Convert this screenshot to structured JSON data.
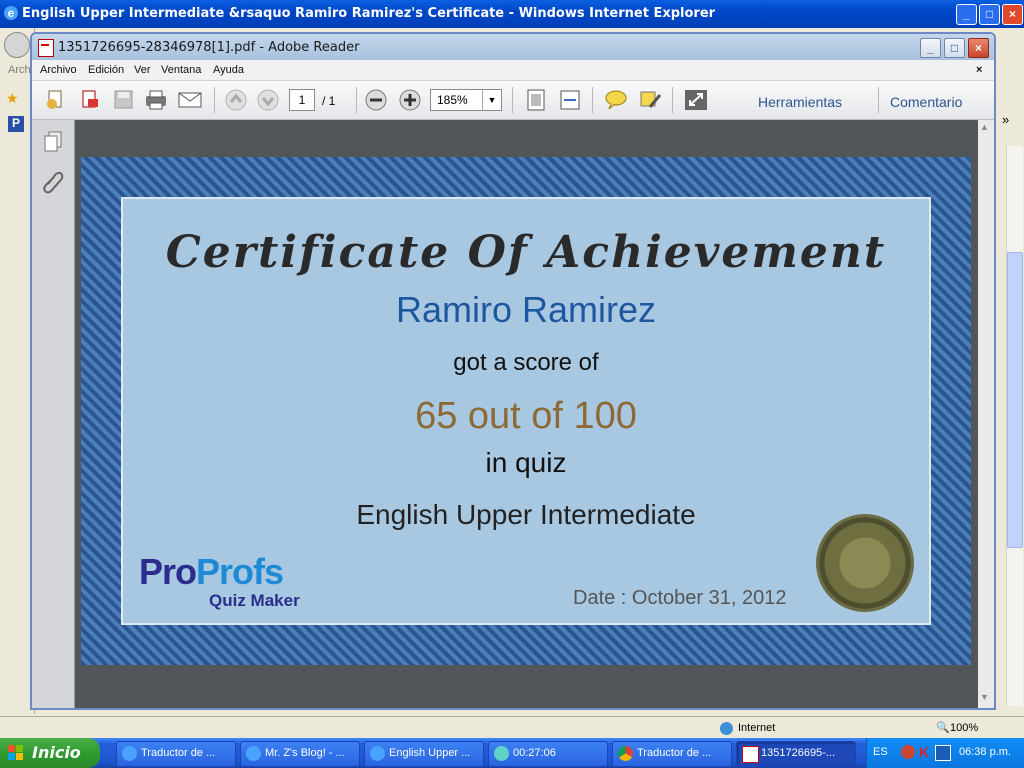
{
  "ie": {
    "title": "English Upper Intermediate &rsaquo Ramiro Ramirez's Certificate - Windows Internet Explorer",
    "status_zone": "Internet",
    "status_zoom": "100%",
    "fav_fragment": "Arch"
  },
  "adobe": {
    "title": "1351726695-28346978[1].pdf - Adobe Reader",
    "menu": [
      "Archivo",
      "Edición",
      "Ver",
      "Ventana",
      "Ayuda"
    ],
    "page_current": "1",
    "page_total": "/ 1",
    "zoom": "185%",
    "tools_label": "Herramientas",
    "comment_label": "Comentario"
  },
  "certificate": {
    "title": "Certificate Of Achievement",
    "name": "Ramiro Ramirez",
    "score_prefix": "got a score of",
    "score": "65 out of 100",
    "quiz_prefix": "in quiz",
    "quiz_name": "English Upper Intermediate",
    "date": "Date : October 31, 2012",
    "logo_pro": "Pro",
    "logo_profs": "Profs",
    "logo_sub": "Quiz Maker"
  },
  "taskbar": {
    "start": "Inicio",
    "tasks": [
      {
        "label": "Traductor de ...",
        "icon": "ie-icon"
      },
      {
        "label": "Mr. Z's Blog! - ...",
        "icon": "ie-icon"
      },
      {
        "label": "English Upper ...",
        "icon": "ie-icon"
      },
      {
        "label": "00:27:06",
        "icon": "timer-icon"
      },
      {
        "label": "Traductor de ...",
        "icon": "chrome-icon"
      },
      {
        "label": "1351726695-...",
        "icon": "pdf-icon"
      }
    ],
    "lang": "ES",
    "clock": "06:38 p.m."
  }
}
